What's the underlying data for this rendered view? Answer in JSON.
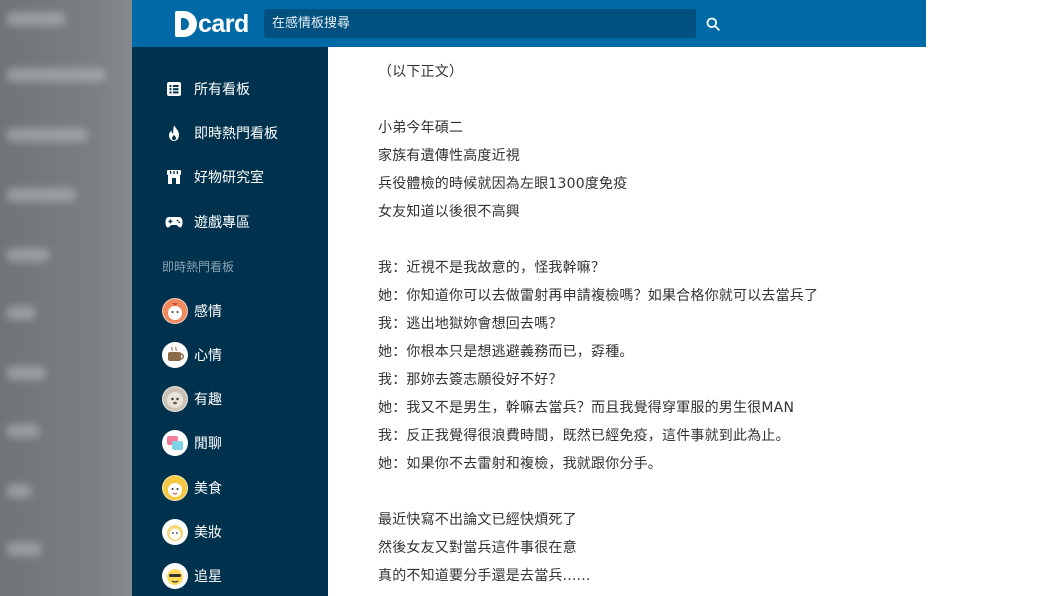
{
  "header": {
    "logo_text": "card",
    "search_placeholder": "在感情板搜尋"
  },
  "sidebar": {
    "nav": [
      {
        "label": "所有看板",
        "icon": "list-icon"
      },
      {
        "label": "即時熱門看板",
        "icon": "flame-icon"
      },
      {
        "label": "好物研究室",
        "icon": "storefront-icon"
      },
      {
        "label": "遊戲專區",
        "icon": "gamepad-icon"
      }
    ],
    "section_title": "即時熱門看板",
    "boards": [
      {
        "label": "感情",
        "avatar_color": "#f08a5d"
      },
      {
        "label": "心情",
        "avatar_color": "#8b6b4a"
      },
      {
        "label": "有趣",
        "avatar_color": "#c9c2b5"
      },
      {
        "label": "閒聊",
        "avatar_color": "#f47c9a"
      },
      {
        "label": "美食",
        "avatar_color": "#f5c842"
      },
      {
        "label": "美妝",
        "avatar_color": "#f7d774"
      },
      {
        "label": "追星",
        "avatar_color": "#ffd95a"
      }
    ]
  },
  "article": {
    "lines": [
      "（以下正文）",
      "",
      "小弟今年碩二",
      "家族有遺傳性高度近視",
      "兵役體檢的時候就因為左眼1300度免疫",
      "女友知道以後很不高興",
      "",
      "我：近視不是我故意的，怪我幹嘛？",
      "她：你知道你可以去做雷射再申請複檢嗎？如果合格你就可以去當兵了",
      "我：逃出地獄妳會想回去嗎？",
      "她：你根本只是想逃避義務而已，孬種。",
      "我：那妳去簽志願役好不好？",
      "她：我又不是男生，幹嘛去當兵？而且我覺得穿軍服的男生很MAN",
      "我：反正我覺得很浪費時間，既然已經免疫，這件事就到此為止。",
      "她：如果你不去雷射和複檢，我就跟你分手。",
      "",
      "最近快寫不出論文已經快煩死了",
      "然後女友又對當兵這件事很在意",
      "真的不知道要分手還是去當兵......"
    ]
  },
  "colors": {
    "header": "#006aa6",
    "sidebar": "#00324e",
    "text": "#333333"
  }
}
